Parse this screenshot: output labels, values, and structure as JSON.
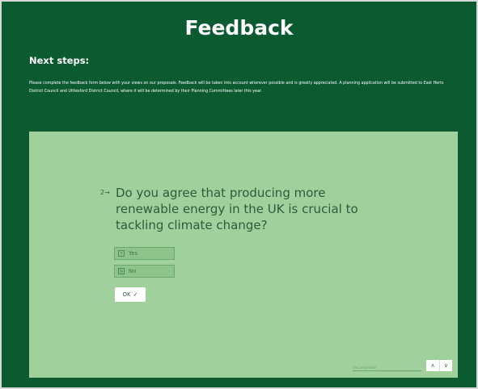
{
  "header": {
    "title": "Feedback"
  },
  "next_steps": {
    "heading": "Next steps:",
    "body": "Please complete the feedback form below with your views on our proposals. Feedback will be taken into account wherever possible and is greatly appreciated. A planning application will be submitted to East Herts District Council and Uttlesford District Council, where it will be determined by their Planning Committees later this year."
  },
  "form": {
    "question_number": "2→",
    "question": "Do you agree that producing more renewable energy in the UK is crucial to tackling climate change?",
    "choices": [
      {
        "key": "Y",
        "label": "Yes"
      },
      {
        "key": "N",
        "label": "No"
      }
    ],
    "ok_label": "OK",
    "ok_icon": "✓",
    "progress_text": "0% completed",
    "nav_up_icon": "∧",
    "nav_down_icon": "∨"
  },
  "colors": {
    "background": "#0b5a30",
    "panel": "#a0d09b",
    "question_text": "#2f5a3d"
  }
}
